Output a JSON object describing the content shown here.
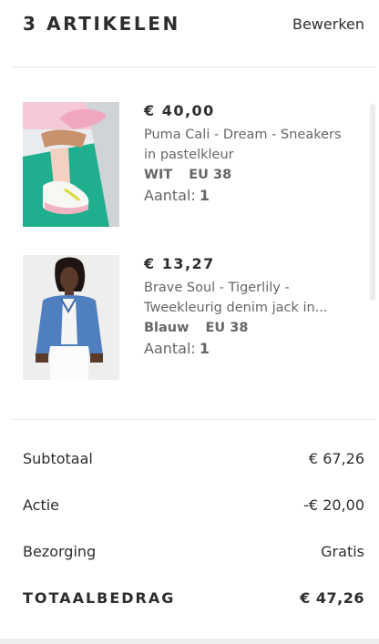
{
  "header": {
    "title": "3 ARTIKELEN",
    "edit_label": "Bewerken"
  },
  "items": [
    {
      "price": "€ 40,00",
      "name": "Puma Cali - Dream - Sneakers in pastelkleur",
      "color": "WIT",
      "size": "EU 38",
      "qty_label": "Aantal:",
      "qty": "1"
    },
    {
      "price": "€ 13,27",
      "name": "Brave Soul - Tigerlily - Tweekleurig denim jack in...",
      "color": "Blauw",
      "size": "EU 38",
      "qty_label": "Aantal:",
      "qty": "1"
    }
  ],
  "summary": {
    "subtotal_label": "Subtotaal",
    "subtotal_value": "€ 67,26",
    "discount_label": "Actie",
    "discount_value": "-€ 20,00",
    "shipping_label": "Bezorging",
    "shipping_value": "Gratis",
    "total_label": "TOTAALBEDRAG",
    "total_value": "€ 47,26"
  }
}
